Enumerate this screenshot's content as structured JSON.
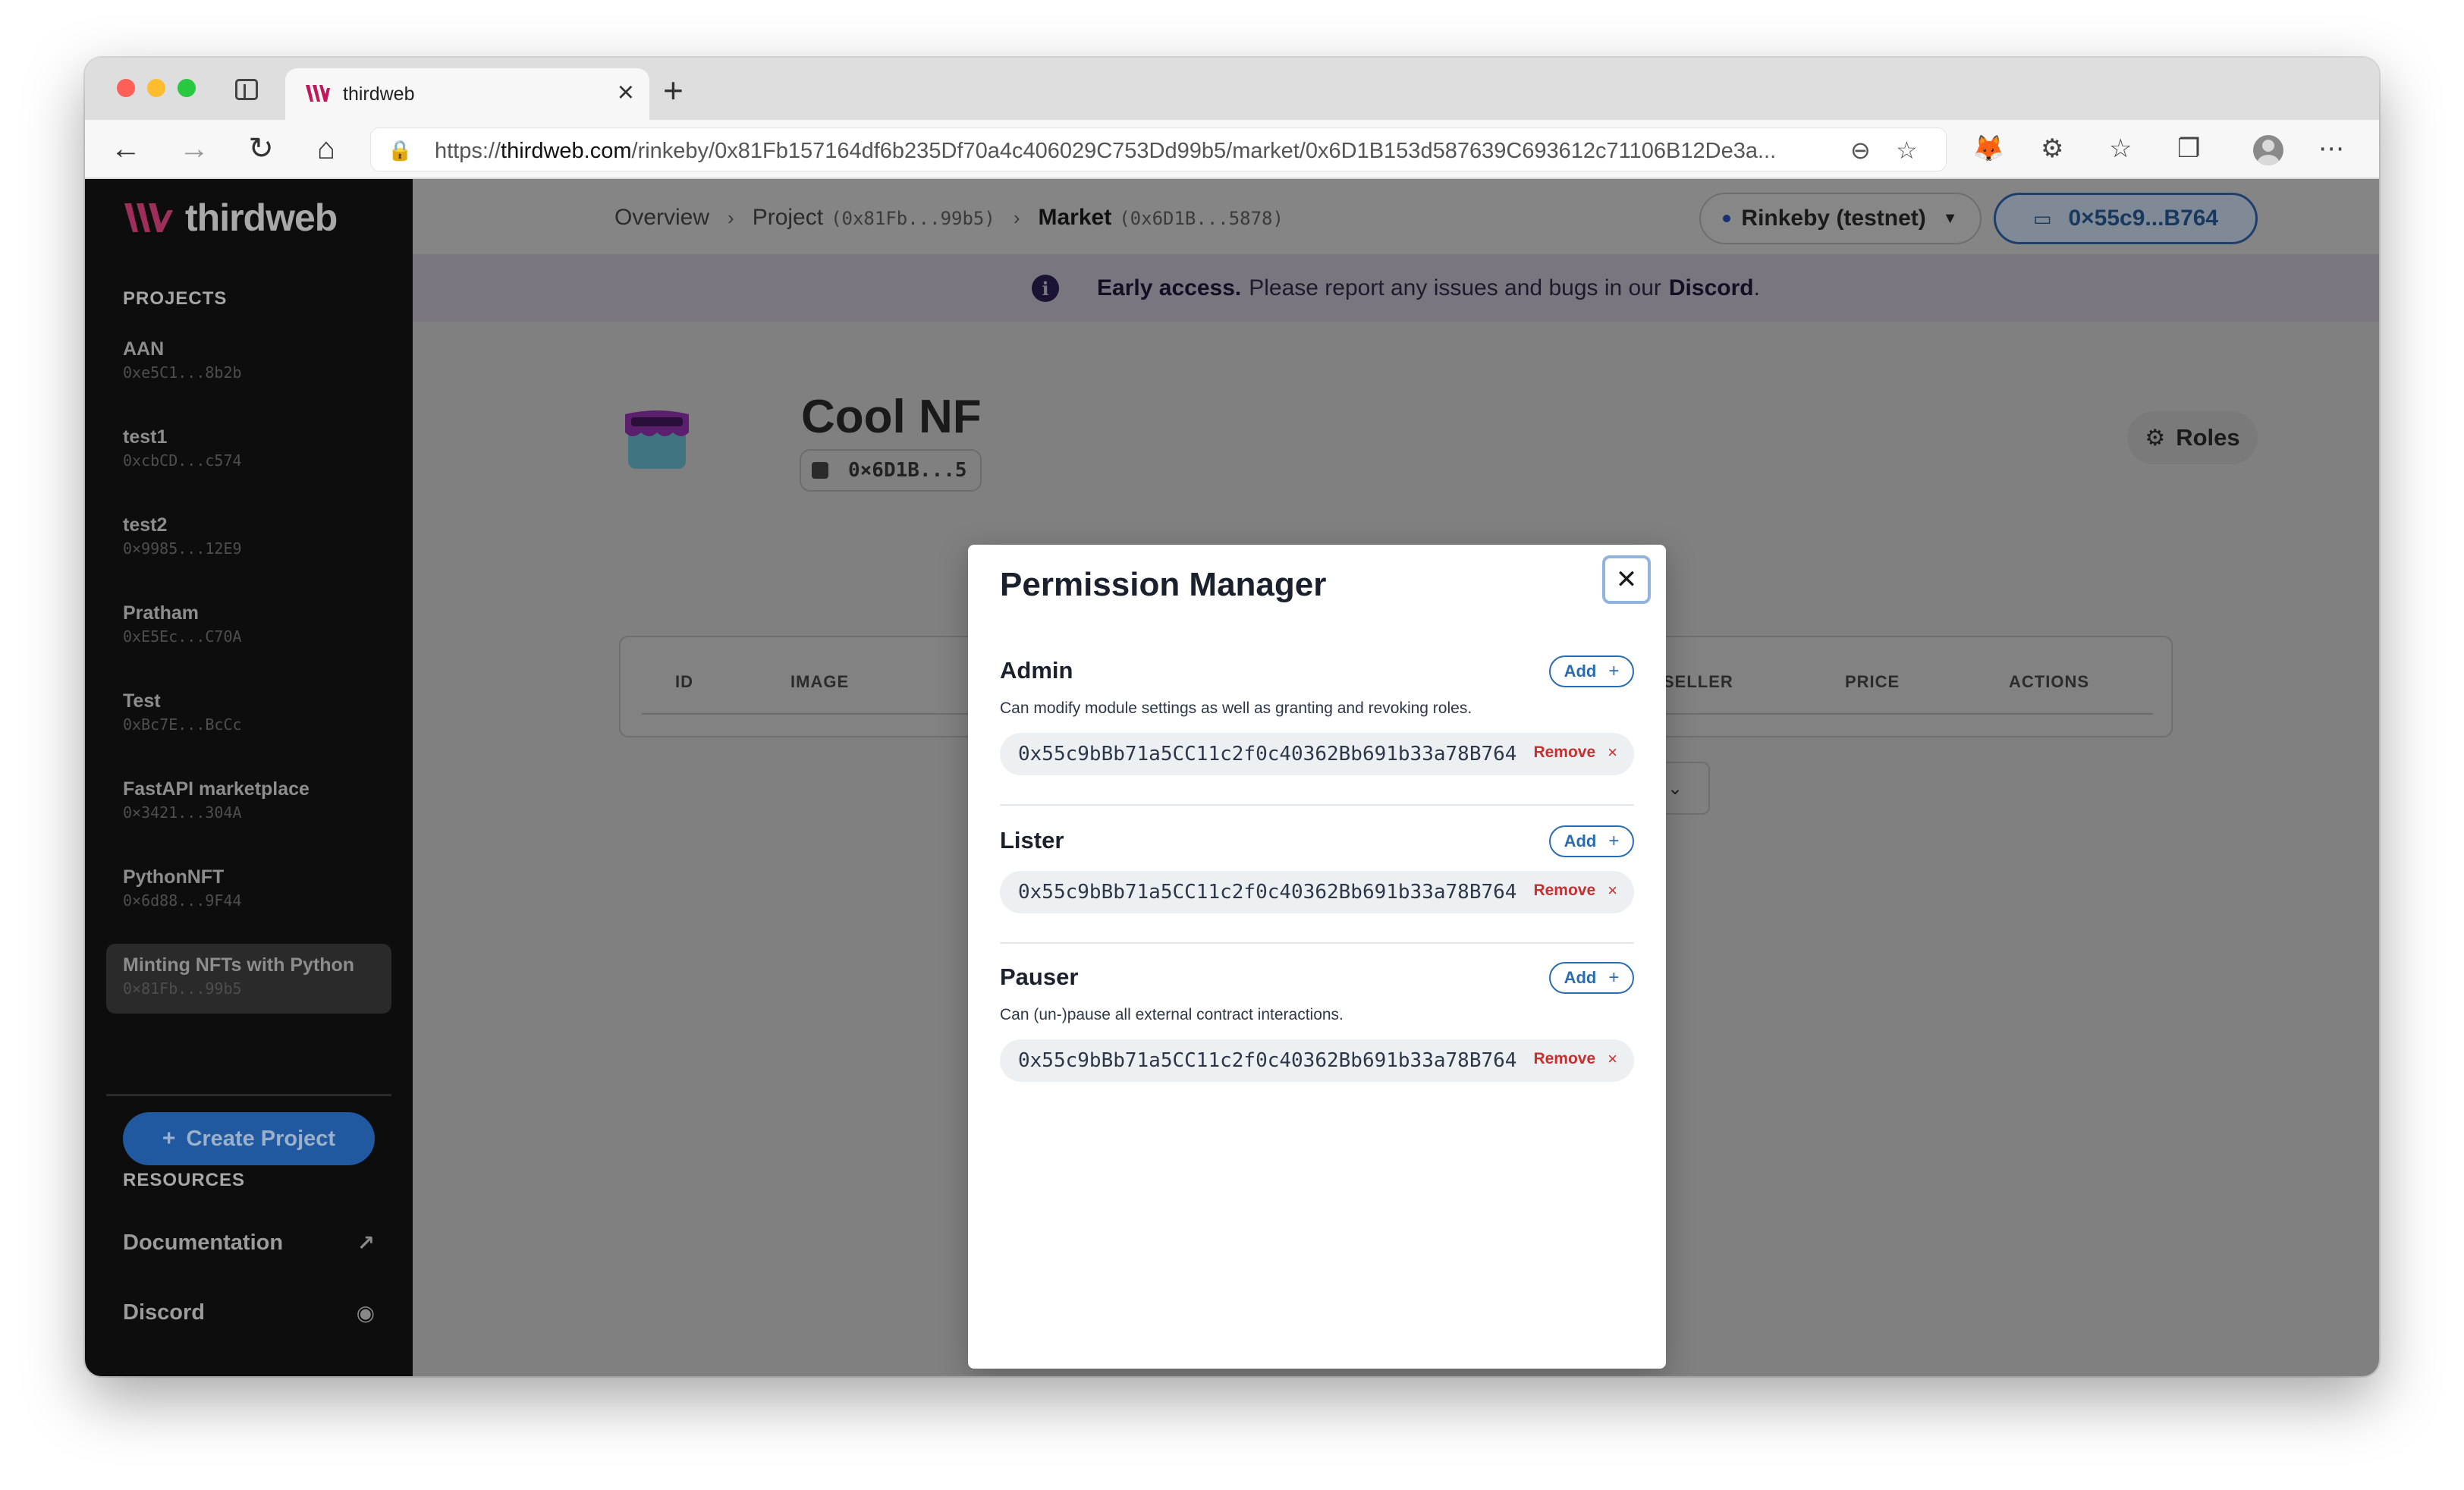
{
  "browser": {
    "tab_title": "thirdweb",
    "url_scheme": "https://",
    "url_host": "thirdweb.com",
    "url_path": "/rinkeby/0x81Fb157164df6b235Df70a4c406029C753Dd99b5/market/0x6D1B153d587639C693612c71106B12De3a..."
  },
  "sidebar": {
    "logo_text": "thirdweb",
    "projects_heading": "PROJECTS",
    "projects": [
      {
        "name": "AAN",
        "address": "0xe5C1...8b2b"
      },
      {
        "name": "test1",
        "address": "0xcbCD...c574"
      },
      {
        "name": "test2",
        "address": "0×9985...12E9"
      },
      {
        "name": "Pratham",
        "address": "0xE5Ec...C70A"
      },
      {
        "name": "Test",
        "address": "0xBc7E...BcCc"
      },
      {
        "name": "FastAPI marketplace",
        "address": "0×3421...304A"
      },
      {
        "name": "PythonNFT",
        "address": "0×6d88...9F44"
      },
      {
        "name": "Minting NFTs with Python",
        "address": "0×81Fb...99b5"
      }
    ],
    "create_project_label": "Create Project",
    "resources_heading": "RESOURCES",
    "resources": [
      {
        "label": "Documentation",
        "icon": "external-link-icon"
      },
      {
        "label": "Discord",
        "icon": "discord-icon"
      }
    ]
  },
  "header": {
    "breadcrumb": [
      {
        "label": "Overview",
        "address": ""
      },
      {
        "label": "Project",
        "address": "(0x81Fb...99b5)"
      },
      {
        "label": "Market",
        "address": "(0x6D1B...5878)"
      }
    ],
    "network_label": "Rinkeby (testnet)",
    "wallet_label": "0×55c9...B764"
  },
  "banner": {
    "bold": "Early access.",
    "text": "Please report any issues and bugs in our",
    "link": "Discord",
    "suffix": "."
  },
  "module": {
    "title": "Cool NF",
    "address": "0×6D1B...5",
    "roles_label": "Roles"
  },
  "table": {
    "columns": [
      "ID",
      "IMAGE",
      "SELLER",
      "PRICE",
      "ACTIONS"
    ]
  },
  "modal": {
    "title": "Permission Manager",
    "add_label": "Add",
    "remove_label": "Remove",
    "roles": [
      {
        "name": "Admin",
        "description": "Can modify module settings as well as granting and revoking roles.",
        "members": [
          "0x55c9bBb71a5CC11c2f0c40362Bb691b33a78B764"
        ]
      },
      {
        "name": "Lister",
        "description": "",
        "members": [
          "0x55c9bBb71a5CC11c2f0c40362Bb691b33a78B764"
        ]
      },
      {
        "name": "Pauser",
        "description": "Can (un-)pause all external contract interactions.",
        "members": [
          "0x55c9bBb71a5CC11c2f0c40362Bb691b33a78B764"
        ]
      }
    ]
  },
  "colors": {
    "accent_blue": "#2b6cb0",
    "remove_red": "#c53030",
    "sidebar_bg": "#0d0d0d"
  }
}
